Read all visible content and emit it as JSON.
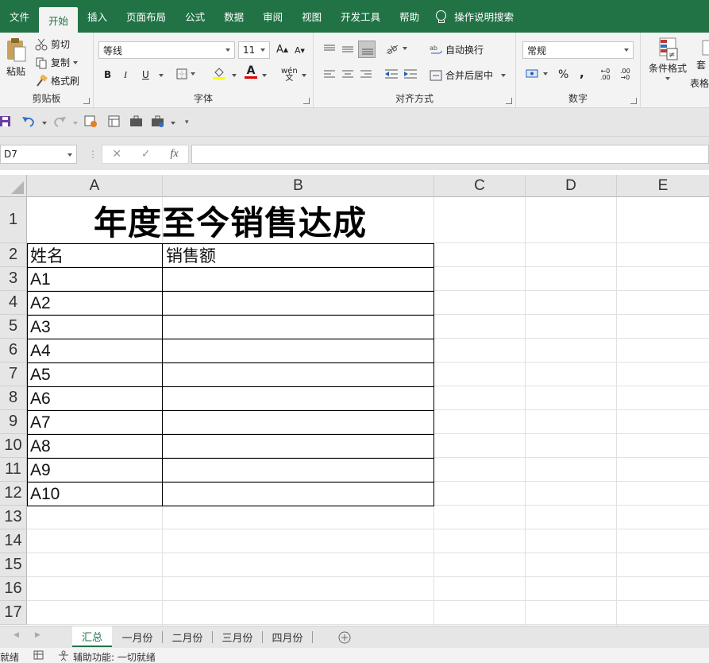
{
  "ribbon_tabs": [
    "文件",
    "开始",
    "插入",
    "页面布局",
    "公式",
    "数据",
    "审阅",
    "视图",
    "开发工具",
    "帮助",
    "操作说明搜索"
  ],
  "clipboard": {
    "paste": "粘贴",
    "cut": "剪切",
    "copy": "复制",
    "format_painter": "格式刷",
    "label": "剪贴板"
  },
  "font": {
    "name": "等线",
    "size": "11",
    "label": "字体",
    "bold": "B",
    "italic": "I",
    "underline": "U",
    "wen": "wén"
  },
  "alignment": {
    "wrap": "自动换行",
    "merge": "合并后居中",
    "label": "对齐方式"
  },
  "number": {
    "format": "常规",
    "label": "数字",
    "percent": "%",
    "comma": ","
  },
  "styles": {
    "conditional": "条件格式",
    "table_partial": "套\n表格"
  },
  "formula_bar": {
    "name_box": "D7",
    "fx": "fx",
    "cancel": "✕",
    "enter": "✓"
  },
  "columns": [
    "A",
    "B",
    "C",
    "D",
    "E"
  ],
  "rows": [
    "1",
    "2",
    "3",
    "4",
    "5",
    "6",
    "7",
    "8",
    "9",
    "10",
    "11",
    "12",
    "13",
    "14",
    "15",
    "16",
    "17"
  ],
  "sheet": {
    "title": "年度至今销售达成",
    "header": [
      "姓名",
      "销售额"
    ],
    "names": [
      "A1",
      "A2",
      "A3",
      "A4",
      "A5",
      "A6",
      "A7",
      "A8",
      "A9",
      "A10"
    ]
  },
  "sheet_tabs": [
    "汇总",
    "一月份",
    "二月份",
    "三月份",
    "四月份"
  ],
  "status": {
    "ready": "就绪",
    "accessibility": "辅助功能: 一切就绪"
  },
  "colors": {
    "excel_green": "#217346",
    "font_red": "#e00000",
    "highlight_yellow": "#ffff00"
  }
}
